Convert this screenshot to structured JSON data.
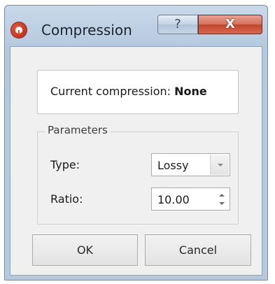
{
  "window": {
    "title": "Compression",
    "help_label": "?",
    "close_label": "X"
  },
  "status": {
    "label": "Current compression:",
    "value": "None"
  },
  "parameters": {
    "legend": "Parameters",
    "type_label": "Type:",
    "type_value": "Lossy",
    "ratio_label": "Ratio:",
    "ratio_value": "10.00"
  },
  "buttons": {
    "ok": "OK",
    "cancel": "Cancel"
  }
}
